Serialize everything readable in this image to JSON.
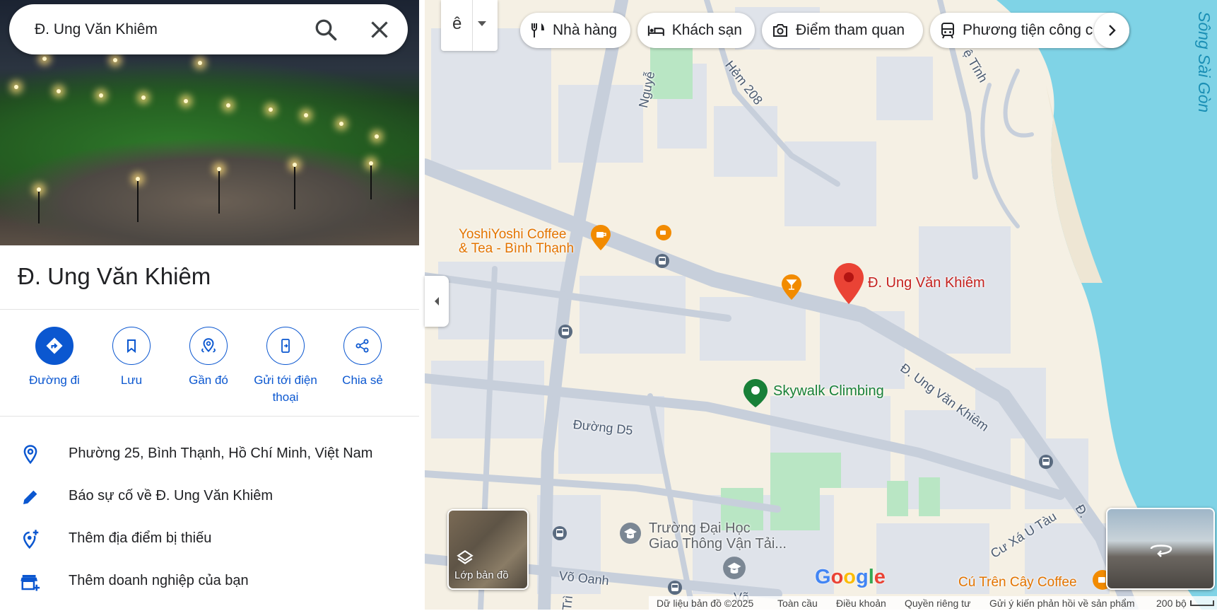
{
  "search": {
    "value": "Đ. Ung Văn Khiêm"
  },
  "place": {
    "title": "Đ. Ung Văn Khiêm"
  },
  "actions": [
    {
      "label": "Đường đi",
      "icon": "directions-icon"
    },
    {
      "label": "Lưu",
      "icon": "bookmark-icon"
    },
    {
      "label": "Gần đó",
      "icon": "nearby-icon"
    },
    {
      "label": "Gửi tới điện thoại",
      "icon": "send-to-phone-icon"
    },
    {
      "label": "Chia sẻ",
      "icon": "share-icon"
    }
  ],
  "info": [
    {
      "text": "Phường 25, Bình Thạnh, Hồ Chí Minh, Việt Nam",
      "icon": "location-pin-icon"
    },
    {
      "text": "Báo sự cố về Đ. Ung Văn Khiêm",
      "icon": "pencil-icon"
    },
    {
      "text": "Thêm địa điểm bị thiếu",
      "icon": "add-location-icon"
    },
    {
      "text": "Thêm doanh nghiệp của bạn",
      "icon": "add-business-icon"
    }
  ],
  "map": {
    "language_label": "ê",
    "chips": [
      {
        "label": "Nhà hàng",
        "icon": "restaurant-icon"
      },
      {
        "label": "Khách sạn",
        "icon": "hotel-icon"
      },
      {
        "label": "Điểm tham quan",
        "icon": "camera-icon"
      },
      {
        "label": "Phương tiện công c",
        "icon": "transit-icon"
      }
    ],
    "labels": {
      "poi_coffee": "YoshiYoshi Coffee\n& Tea - Bình Thạnh",
      "pin": "Đ. Ung Văn Khiêm",
      "skywalk": "Skywalk Climbing",
      "street_main": "Đ. Ung Văn Khiêm",
      "street_d5": "Đường D5",
      "university": "Trường Đại Học\nGiao Thông Vận Tải...",
      "vo_oanh": "Võ Oanh",
      "cu_xa": "Cư Xá U Tàu",
      "cafe_bottom": "Cú Trên Cây Coffee",
      "hem": "Hẻm 208",
      "nguyen": "Nguyễ",
      "tinh": "ệ Tĩnh",
      "river": "Sông Sài Gòn",
      "vo": "Võ",
      "tri": "Trì",
      "d_short": "Đ."
    },
    "layers_label": "Lớp bản đồ",
    "logo": "Google",
    "footer": {
      "data": "Dữ liệu bản đồ ©2025",
      "global": "Toàn cầu",
      "terms": "Điều khoản",
      "privacy": "Quyền riêng tư",
      "feedback": "Gửi ý kiến phản hồi về sản phẩm",
      "scale": "200 bộ"
    },
    "colors": {
      "water": "#7fd3e6",
      "land": "#f5f0e4",
      "blocks": "#dfe3ea",
      "roads": "#c7cfdb",
      "park": "#b9e6c4",
      "pin": "#ea4335"
    }
  }
}
